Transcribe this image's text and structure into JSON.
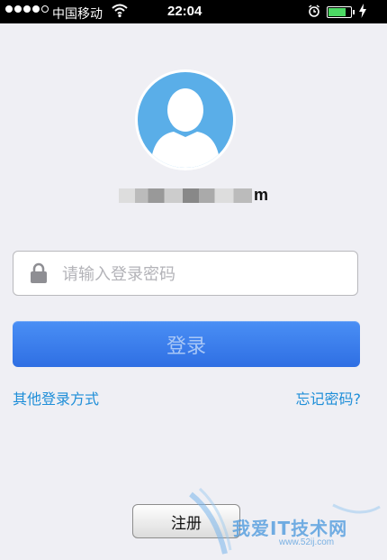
{
  "status_bar": {
    "carrier": "中国移动",
    "time": "22:04",
    "battery_level": 0.8
  },
  "account": {
    "username_suffix": "m"
  },
  "login": {
    "password_placeholder": "请输入登录密码",
    "login_label": "登录",
    "other_methods_label": "其他登录方式",
    "forgot_password_label": "忘记密码?",
    "register_label": "注册"
  },
  "watermark": {
    "title": "我爱IT技术网",
    "url": "www.52ij.com"
  },
  "colors": {
    "accent": "#2f6fe3",
    "link": "#1e8ed8",
    "avatar_bg": "#5aaee8",
    "background": "#efeff4"
  },
  "icons": [
    "wifi-icon",
    "alarm-icon",
    "battery-icon",
    "charging-icon",
    "avatar-icon",
    "lock-icon"
  ]
}
